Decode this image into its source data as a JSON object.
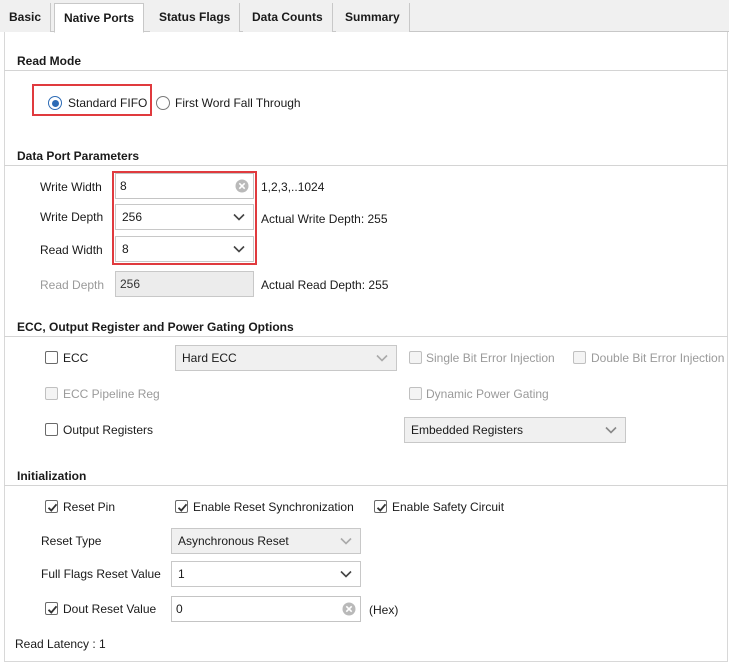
{
  "tabs": [
    {
      "label": "Basic"
    },
    {
      "label": "Native Ports"
    },
    {
      "label": "Status Flags"
    },
    {
      "label": "Data Counts"
    },
    {
      "label": "Summary"
    }
  ],
  "read_mode": {
    "title": "Read Mode",
    "standard_fifo": "Standard FIFO",
    "fwft": "First Word Fall Through",
    "selected": "Standard FIFO"
  },
  "data_port": {
    "title": "Data Port Parameters",
    "write_width_label": "Write Width",
    "write_width_value": "8",
    "write_width_hint": "1,2,3,..1024",
    "write_depth_label": "Write Depth",
    "write_depth_value": "256",
    "write_depth_hint": "Actual Write Depth: 255",
    "read_width_label": "Read Width",
    "read_width_value": "8",
    "read_depth_label": "Read Depth",
    "read_depth_value": "256",
    "read_depth_hint": "Actual Read Depth: 255"
  },
  "ecc": {
    "title": "ECC, Output Register and Power Gating Options",
    "ecc_label": "ECC",
    "ecc_checked": false,
    "ecc_type": "Hard ECC",
    "single_bit": "Single Bit Error Injection",
    "double_bit": "Double Bit Error Injection",
    "pipeline_reg": "ECC Pipeline Reg",
    "dynamic_power": "Dynamic Power Gating",
    "output_registers": "Output Registers",
    "output_registers_checked": false,
    "register_type": "Embedded Registers"
  },
  "init": {
    "title": "Initialization",
    "reset_pin": "Reset Pin",
    "reset_pin_checked": true,
    "enable_reset_sync": "Enable Reset Synchronization",
    "enable_reset_sync_checked": true,
    "enable_safety": "Enable Safety Circuit",
    "enable_safety_checked": true,
    "reset_type_label": "Reset Type",
    "reset_type_value": "Asynchronous Reset",
    "full_flags_label": "Full Flags Reset Value",
    "full_flags_value": "1",
    "dout_reset_label": "Dout Reset Value",
    "dout_reset_checked": true,
    "dout_reset_value": "0",
    "dout_reset_unit": "(Hex)"
  },
  "footer": {
    "read_latency": "Read Latency : 1"
  },
  "colors": {
    "highlight": "#e03a3e",
    "radio_accent": "#2d6bb5"
  }
}
